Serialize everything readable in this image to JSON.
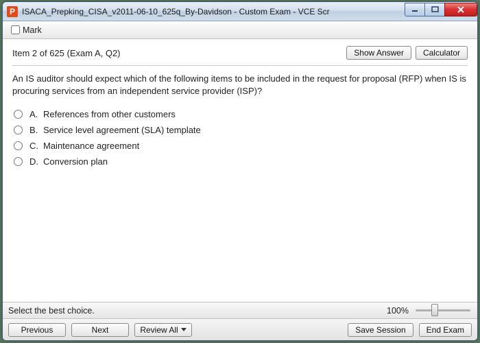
{
  "window": {
    "title": "ISACA_Prepking_CISA_v2011-06-10_625q_By-Davidson - Custom Exam - VCE Scr"
  },
  "toolbar": {
    "mark_label": "Mark",
    "mark_checked": false
  },
  "header": {
    "item_position": "Item 2 of 625  (Exam A, Q2)",
    "show_answer": "Show Answer",
    "calculator": "Calculator"
  },
  "question": {
    "text": "An IS auditor should expect which of the following items to be included in the request for proposal (RFP) when IS is procuring services from an independent service provider (ISP)?",
    "options": [
      {
        "letter": "A.",
        "text": "References from other customers"
      },
      {
        "letter": "B.",
        "text": "Service level agreement (SLA) template"
      },
      {
        "letter": "C.",
        "text": "Maintenance agreement"
      },
      {
        "letter": "D.",
        "text": "Conversion plan"
      }
    ]
  },
  "status": {
    "hint": "Select the best choice.",
    "zoom_pct": "100%",
    "zoom_value": 100
  },
  "footer": {
    "previous": "Previous",
    "next": "Next",
    "review_all": "Review All",
    "save_session": "Save Session",
    "end_exam": "End Exam"
  }
}
